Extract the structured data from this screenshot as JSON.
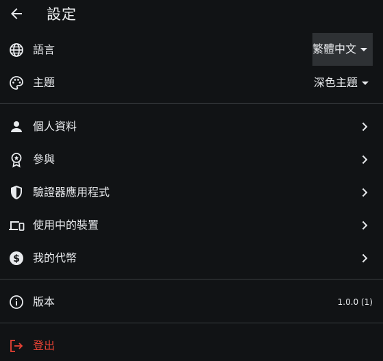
{
  "header": {
    "title": "設定",
    "back_icon": "arrow-back-icon"
  },
  "preferences": {
    "language": {
      "label": "語言",
      "icon": "globe-icon",
      "value": "繁體中文"
    },
    "theme": {
      "label": "主題",
      "icon": "palette-icon",
      "value": "深色主題"
    }
  },
  "account": {
    "items": [
      {
        "label": "個人資料",
        "icon": "person-icon"
      },
      {
        "label": "參與",
        "icon": "award-ribbon-icon"
      },
      {
        "label": "驗證器應用程式",
        "icon": "shield-icon"
      },
      {
        "label": "使用中的裝置",
        "icon": "devices-icon"
      },
      {
        "label": "我的代幣",
        "icon": "dollar-coin-icon"
      }
    ]
  },
  "about": {
    "label": "版本",
    "icon": "info-icon",
    "value": "1.0.0 (1)"
  },
  "logout": {
    "label": "登出",
    "icon": "logout-icon",
    "color": "#ea4335"
  },
  "colors": {
    "background": "#111315",
    "text": "#e8eaed",
    "divider": "#3c4043",
    "select_highlight": "#2e3134",
    "danger": "#ea4335"
  }
}
